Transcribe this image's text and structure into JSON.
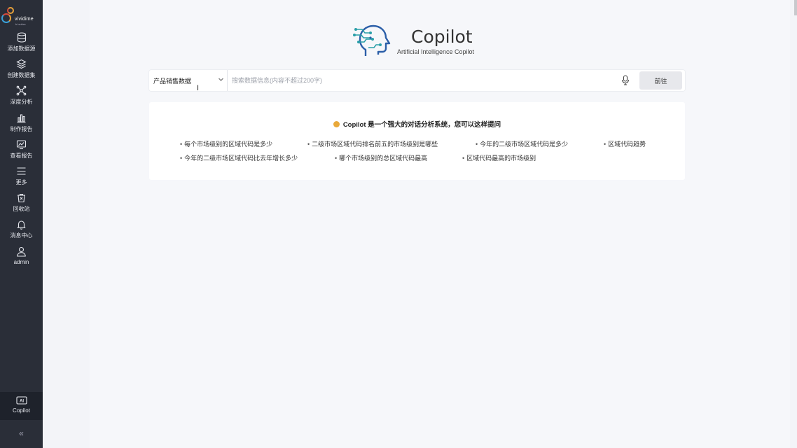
{
  "sidebar": {
    "logo": {
      "name": "vividime",
      "sub": "bi suites"
    },
    "items": [
      {
        "label": "添加数据源",
        "icon": "database-icon"
      },
      {
        "label": "创建数据集",
        "icon": "layers-icon"
      },
      {
        "label": "深度分析",
        "icon": "network-icon"
      },
      {
        "label": "制作报告",
        "icon": "bar-chart-icon"
      },
      {
        "label": "查看报告",
        "icon": "report-icon"
      },
      {
        "label": "更多",
        "icon": "menu-icon"
      },
      {
        "label": "回收站",
        "icon": "trash-icon"
      },
      {
        "label": "消息中心",
        "icon": "bell-icon"
      },
      {
        "label": "admin",
        "icon": "user-icon"
      }
    ],
    "copilot": {
      "label": "Copilot",
      "badge": "AI",
      "icon": "ai-icon"
    },
    "collapse": "«"
  },
  "brand": {
    "title": "Copilot",
    "subtitle": "Artificial Intelligence Copilot"
  },
  "search": {
    "datasource": "产品销售数据",
    "placeholder": "搜索数据信息(内容不超过200字)",
    "value": "",
    "go_label": "前往"
  },
  "suggestions": {
    "title": "Copilot 是一个强大的对话分析系统，您可以这样提问",
    "items": [
      "每个市场级别的区域代码是多少",
      "二级市场区域代码排名前五的市场级别是哪些",
      "今年的二级市场区域代码是多少",
      "区域代码趋势",
      "今年的二级市场区域代码比去年增长多少",
      "哪个市场级别的总区域代码最高",
      "区域代码最高的市场级别"
    ]
  },
  "colors": {
    "sidebar_bg": "#2a2e38",
    "accent_teal": "#2a9fa8",
    "accent_blue": "#2c5fa8"
  }
}
